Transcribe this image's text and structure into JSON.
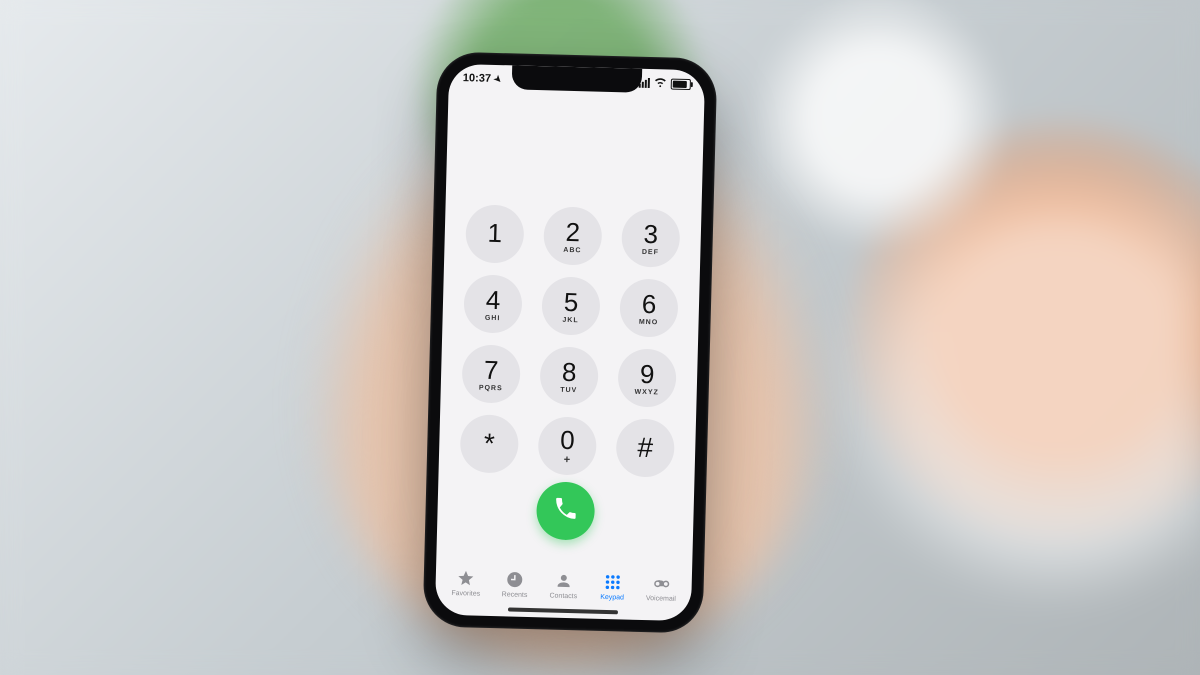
{
  "status": {
    "time": "10:37"
  },
  "keypad": {
    "k1": {
      "num": "1",
      "sub": ""
    },
    "k2": {
      "num": "2",
      "sub": "ABC"
    },
    "k3": {
      "num": "3",
      "sub": "DEF"
    },
    "k4": {
      "num": "4",
      "sub": "GHI"
    },
    "k5": {
      "num": "5",
      "sub": "JKL"
    },
    "k6": {
      "num": "6",
      "sub": "MNO"
    },
    "k7": {
      "num": "7",
      "sub": "PQRS"
    },
    "k8": {
      "num": "8",
      "sub": "TUV"
    },
    "k9": {
      "num": "9",
      "sub": "WXYZ"
    },
    "kstar": {
      "num": "*",
      "sub": ""
    },
    "k0": {
      "num": "0",
      "sub": "+"
    },
    "khash": {
      "num": "#",
      "sub": ""
    }
  },
  "tabs": {
    "favorites": "Favorites",
    "recents": "Recents",
    "contacts": "Contacts",
    "keypad": "Keypad",
    "voicemail": "Voicemail"
  },
  "colors": {
    "call_green": "#33c759",
    "ios_blue": "#0a7aff"
  }
}
